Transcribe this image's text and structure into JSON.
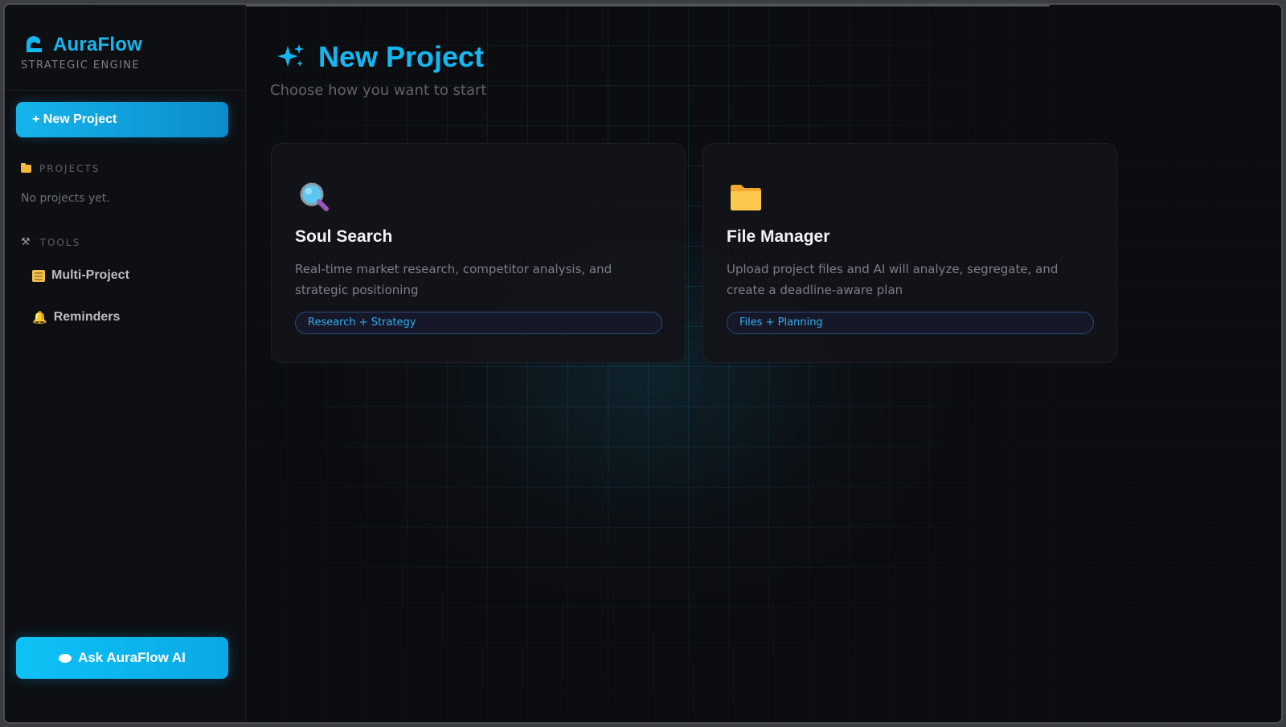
{
  "brand": {
    "name": "AuraFlow",
    "subtitle": "STRATEGIC ENGINE",
    "icon": "cloud-face-icon"
  },
  "sidebar": {
    "new_project_label": "+ New Project",
    "projects_section": {
      "label": "PROJECTS",
      "icon": "folder-icon",
      "empty_text": "No projects yet."
    },
    "tools_section": {
      "label": "TOOLS",
      "icon": "tools-icon",
      "items": [
        {
          "label": "Multi-Project",
          "icon": "memo-icon"
        },
        {
          "label": "Reminders",
          "icon": "bell-icon"
        }
      ]
    },
    "ask_button_label": "Ask AuraFlow AI",
    "ask_button_icon": "speech-bubble-icon"
  },
  "main": {
    "title": "New Project",
    "title_icon": "sparkles-icon",
    "subtitle": "Choose how you want to start",
    "cards": [
      {
        "title": "Soul Search",
        "icon": "magnifier-icon",
        "description": "Real-time market research, competitor analysis, and strategic positioning",
        "tag": "Research + Strategy"
      },
      {
        "title": "File Manager",
        "icon": "folder-icon",
        "description": "Upload project files and AI will analyze, segregate, and create a deadline-aware plan",
        "tag": "Files + Planning"
      }
    ]
  },
  "colors": {
    "accent": "#14b8f0",
    "background": "#0c0d10",
    "card": "#131419",
    "tag_text": "#2fb0ec"
  }
}
